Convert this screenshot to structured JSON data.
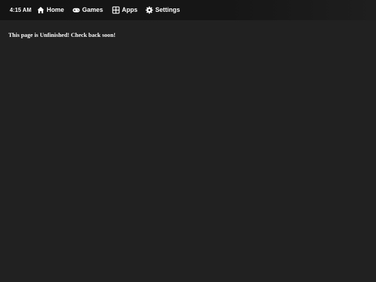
{
  "topbar": {
    "time": "4:15 AM",
    "nav": [
      {
        "label": "Home",
        "icon": "home-icon"
      },
      {
        "label": "Games",
        "icon": "gamepad-icon"
      },
      {
        "label": "Apps",
        "icon": "apps-grid-icon"
      },
      {
        "label": "Settings",
        "icon": "gear-icon"
      }
    ]
  },
  "main": {
    "message": "This page is Unfinished! Check back soon!"
  },
  "colors": {
    "background": "#212121",
    "topbar": "#161616",
    "text": "#ffffff"
  }
}
